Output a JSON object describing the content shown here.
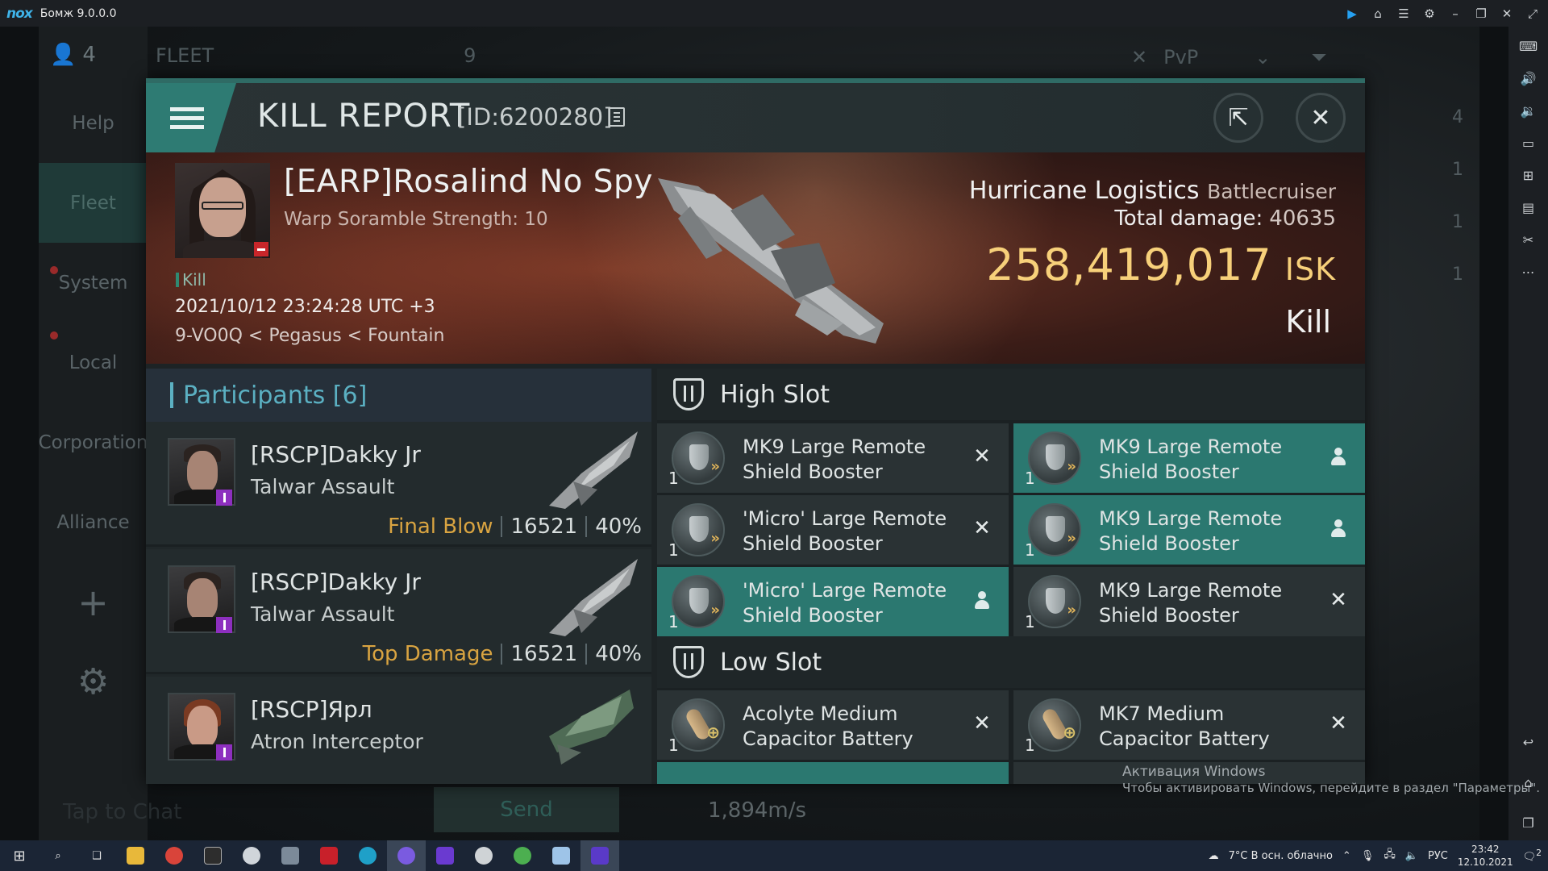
{
  "emulator": {
    "logo": "nox",
    "title": "Бомж 9.0.0.0"
  },
  "game": {
    "member_count": "4",
    "fleet_label": "FLEET",
    "fleet_count": "9",
    "pvp_label": "PvP",
    "left_nav": [
      "Help",
      "Fleet",
      "System",
      "Local",
      "Corporation",
      "Alliance"
    ],
    "chat_placeholder": "Tap to Chat",
    "send_label": "Send",
    "speed": "1,894m/s",
    "right_counts": [
      "4",
      "1",
      "1",
      "1"
    ]
  },
  "kill_report": {
    "title": "KILL REPORT",
    "id_text": "[ID:6200280]",
    "victim": {
      "name": "[EARP]Rosalind No Spy",
      "subtitle": "Warp Soramble Strength: 10",
      "tag": "Kill",
      "datetime": "2021/10/12 23:24:28 UTC +3",
      "location": "9-VO0Q < Pegasus < Fountain"
    },
    "ship": {
      "name": "Hurricane Logistics",
      "class": "Battlecruiser",
      "total_damage_label": "Total damage:",
      "total_damage": "40635",
      "isk_value": "258,419,017",
      "isk_unit": "ISK",
      "result": "Kill"
    },
    "participants": {
      "label": "Participants",
      "count": "[6]",
      "rows": [
        {
          "name": "[RSCP]Dakky Jr",
          "ship": "Talwar Assault",
          "tag": "Final Blow",
          "damage": "16521",
          "percent": "40%"
        },
        {
          "name": "[RSCP]Dakky Jr",
          "ship": "Talwar Assault",
          "tag": "Top Damage",
          "damage": "16521",
          "percent": "40%"
        },
        {
          "name": "[RSCP]Ярл",
          "ship": "Atron Interceptor",
          "tag": "",
          "damage": "",
          "percent": ""
        }
      ]
    },
    "high_slot": {
      "label": "High Slot",
      "modules": [
        {
          "qty": "1",
          "name1": "MK9 Large Remote",
          "name2": "Shield Booster",
          "status": "destroyed",
          "highlight": false
        },
        {
          "qty": "1",
          "name1": "MK9 Large Remote",
          "name2": "Shield Booster",
          "status": "dropped",
          "highlight": true
        },
        {
          "qty": "1",
          "name1": "'Micro' Large Remote",
          "name2": "Shield Booster",
          "status": "destroyed",
          "highlight": false
        },
        {
          "qty": "1",
          "name1": "MK9 Large Remote",
          "name2": "Shield Booster",
          "status": "dropped",
          "highlight": true
        },
        {
          "qty": "1",
          "name1": "'Micro' Large Remote",
          "name2": "Shield Booster",
          "status": "dropped",
          "highlight": true
        },
        {
          "qty": "1",
          "name1": "MK9 Large Remote",
          "name2": "Shield Booster",
          "status": "destroyed",
          "highlight": false
        }
      ]
    },
    "low_slot": {
      "label": "Low Slot",
      "modules": [
        {
          "qty": "1",
          "name1": "Acolyte Medium",
          "name2": "Capacitor Battery",
          "status": "destroyed",
          "highlight": false
        },
        {
          "qty": "1",
          "name1": "MK7 Medium",
          "name2": "Capacitor Battery",
          "status": "destroyed",
          "highlight": false
        }
      ]
    }
  },
  "windows": {
    "watermark_title": "Активация Windows",
    "watermark_text": "Чтобы активировать Windows, перейдите в раздел \"Параметры\".",
    "weather": "7°C  В осн. облачно",
    "lang": "РУС",
    "time": "23:42",
    "date": "12.10.2021",
    "notif_count": "2"
  },
  "colors": {
    "accent": "#2b7870",
    "isk": "#f7d07a",
    "final_blow": "#d9a441",
    "participants": "#5bb0c2"
  }
}
